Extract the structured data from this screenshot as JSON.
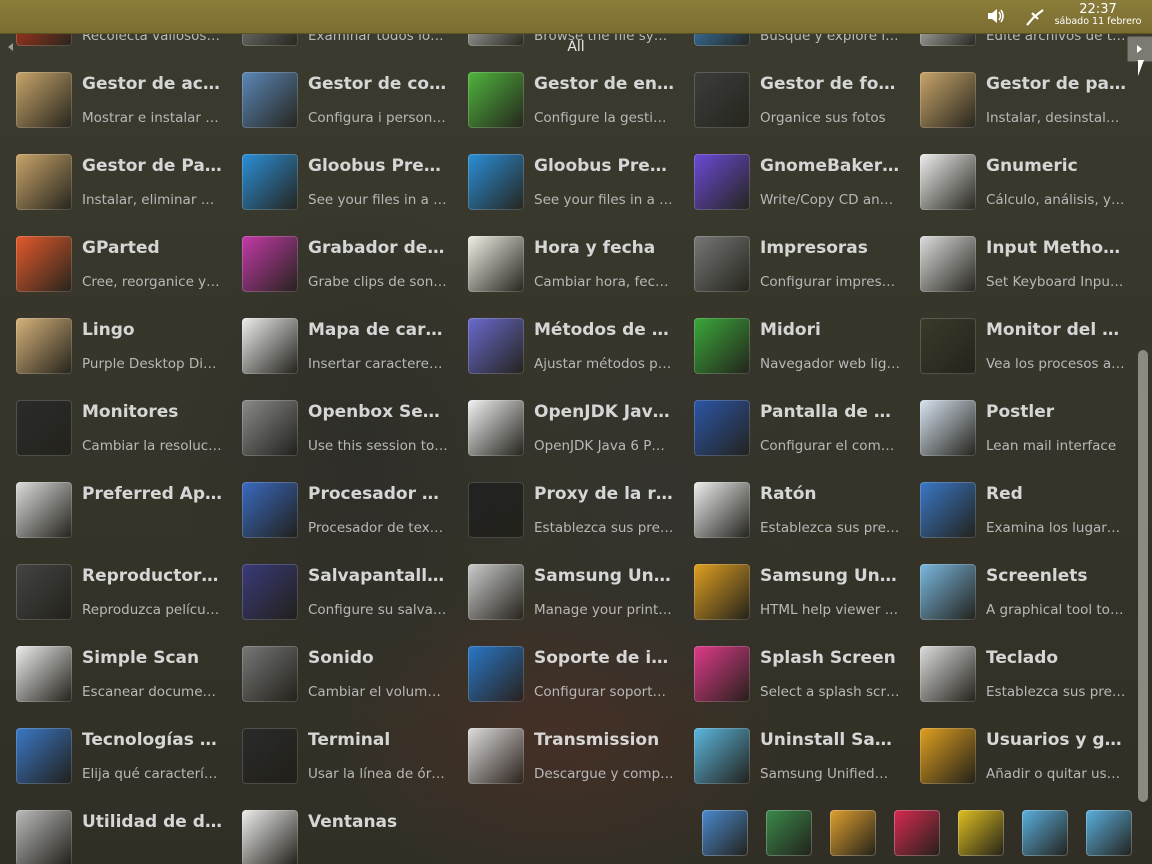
{
  "topbar": {
    "time": "22:37",
    "date": "sábado 11 febrero",
    "icons": [
      "volume-icon",
      "network-icon"
    ]
  },
  "filter": {
    "label": "All"
  },
  "apps": [
    {
      "name": "",
      "desc": "Recolecta valiosos…",
      "icon": "game-icon",
      "color": "#d83a1a"
    },
    {
      "name": "",
      "desc": "Examinar todos los…",
      "icon": "drive-icon",
      "color": "#888"
    },
    {
      "name": "",
      "desc": "Browse the file sys…",
      "icon": "files-icon",
      "color": "#ccc"
    },
    {
      "name": "",
      "desc": "Busque y explore i…",
      "icon": "search-icon",
      "color": "#3b8fd8"
    },
    {
      "name": "",
      "desc": "Edite archivos de t…",
      "icon": "text-editor-icon",
      "color": "#ddd"
    },
    {
      "name": "Gestor de act…",
      "desc": "Mostrar e instalar l…",
      "icon": "package-update-icon",
      "color": "#c9a56a"
    },
    {
      "name": "Gestor de co…",
      "desc": "Configura i person…",
      "icon": "settings-tools-icon",
      "color": "#5b87b8"
    },
    {
      "name": "Gestor de ene…",
      "desc": "Configure la gestió…",
      "icon": "battery-icon",
      "color": "#4fb53c"
    },
    {
      "name": "Gestor de fot…",
      "desc": "Organice sus fotos",
      "icon": "photo-lens-icon",
      "color": "#3c3c3c"
    },
    {
      "name": "Gestor de pa…",
      "desc": "Instalar, desinstala…",
      "icon": "package-install-icon",
      "color": "#c9a56a"
    },
    {
      "name": "Gestor de Pa…",
      "desc": "Instalar, eliminar y …",
      "icon": "package-install-icon",
      "color": "#c9a56a"
    },
    {
      "name": "Gloobus Prev…",
      "desc": "See your files in a …",
      "icon": "gloobus-icon",
      "color": "#2a8fd8"
    },
    {
      "name": "Gloobus Prev…",
      "desc": "See your files in a …",
      "icon": "gloobus-icon",
      "color": "#2a8fd8"
    },
    {
      "name": "GnomeBaker …",
      "desc": "Write/Copy CD an…",
      "icon": "disc-burner-icon",
      "color": "#6b4ad8"
    },
    {
      "name": "Gnumeric",
      "desc": "Cálculo, análisis, y …",
      "icon": "spreadsheet-icon",
      "color": "#eee"
    },
    {
      "name": "GParted",
      "desc": "Cree, reorganice y…",
      "icon": "partition-icon",
      "color": "#e55a2b"
    },
    {
      "name": "Grabador de …",
      "desc": "Grabe clips de sonido",
      "icon": "microphone-icon",
      "color": "#c33aa8"
    },
    {
      "name": "Hora y fecha",
      "desc": "Cambiar hora, fech…",
      "icon": "clock-icon",
      "color": "#f2efe6"
    },
    {
      "name": "Impresoras",
      "desc": "Configurar impreso…",
      "icon": "printer-icon",
      "color": "#777"
    },
    {
      "name": "Input Method …",
      "desc": "Set Keyboard Inpu…",
      "icon": "keyboard-icon",
      "color": "#ddd"
    },
    {
      "name": "Lingo",
      "desc": "Purple Desktop Di…",
      "icon": "dictionary-icon",
      "color": "#d7b27a"
    },
    {
      "name": "Mapa de cara…",
      "desc": "Insertar caracteres…",
      "icon": "character-map-icon",
      "color": "#eee"
    },
    {
      "name": "Métodos de e…",
      "desc": "Ajustar métodos p…",
      "icon": "info-icon",
      "color": "#6a6ad0"
    },
    {
      "name": "Midori",
      "desc": "Navegador web lig…",
      "icon": "compass-icon",
      "color": "#3aa83a"
    },
    {
      "name": "Monitor del si…",
      "desc": "Vea los procesos a…",
      "icon": "system-monitor-icon",
      "color": "#3a3a2a"
    },
    {
      "name": "Monitores",
      "desc": "Cambiar la resoluc…",
      "icon": "display-icon",
      "color": "#2b2b2b"
    },
    {
      "name": "Openbox Ses…",
      "desc": "Use this session to…",
      "icon": "gear-icon",
      "color": "#8a8a8a"
    },
    {
      "name": "OpenJDK Jav…",
      "desc": "OpenJDK Java 6 P…",
      "icon": "java-icon",
      "color": "#f3f3f3"
    },
    {
      "name": "Pantalla de ac…",
      "desc": "Configurar el comp…",
      "icon": "screen-lock-icon",
      "color": "#2c56a8"
    },
    {
      "name": "Postler",
      "desc": "Lean mail interface",
      "icon": "mail-icon",
      "color": "#d8e4f2"
    },
    {
      "name": "Preferred Ap…",
      "desc": "",
      "icon": "sliders-icon",
      "color": "#ddd"
    },
    {
      "name": "Procesador d…",
      "desc": "Procesador de text…",
      "icon": "writer-icon",
      "color": "#3a6ac0"
    },
    {
      "name": "Proxy de la red",
      "desc": "Establezca sus pre…",
      "icon": "network-proxy-icon",
      "color": "#222"
    },
    {
      "name": "Ratón",
      "desc": "Establezca sus pre…",
      "icon": "mouse-icon",
      "color": "#eee"
    },
    {
      "name": "Red",
      "desc": "Examina los lugare…",
      "icon": "network-places-icon",
      "color": "#3a78c8"
    },
    {
      "name": "Reproductor …",
      "desc": "Reproduzca pelícu…",
      "icon": "video-player-icon",
      "color": "#444"
    },
    {
      "name": "Salvapantallas",
      "desc": "Configure su salva…",
      "icon": "screensaver-icon",
      "color": "#3a3a7a"
    },
    {
      "name": "Samsung Uni…",
      "desc": "Manage your print…",
      "icon": "samsung-printer-icon",
      "color": "#ccc"
    },
    {
      "name": "Samsung Uni…",
      "desc": "HTML help viewer …",
      "icon": "help-book-icon",
      "color": "#e0a020"
    },
    {
      "name": "Screenlets",
      "desc": "A graphical tool to …",
      "icon": "screenlets-icon",
      "color": "#7ab8e0"
    },
    {
      "name": "Simple Scan",
      "desc": "Escanear docume…",
      "icon": "scanner-icon",
      "color": "#eee"
    },
    {
      "name": "Sonido",
      "desc": "Cambiar el volume…",
      "icon": "speaker-icon",
      "color": "#777"
    },
    {
      "name": "Soporte de idi…",
      "desc": "Configurar soporte…",
      "icon": "globe-icon",
      "color": "#2a78c8"
    },
    {
      "name": "Splash Screen",
      "desc": "Select a splash scr…",
      "icon": "color-wheel-icon",
      "color": "#e03a8a"
    },
    {
      "name": "Teclado",
      "desc": "Establezca sus pre…",
      "icon": "keyboard-icon",
      "color": "#ddd"
    },
    {
      "name": "Tecnologías …",
      "desc": "Elija qué caracterís…",
      "icon": "accessibility-icon",
      "color": "#3a78c8"
    },
    {
      "name": "Terminal",
      "desc": "Usar la línea de ór…",
      "icon": "terminal-icon",
      "color": "#2a2a2a"
    },
    {
      "name": "Transmission",
      "desc": "Descargue y comp…",
      "icon": "transmission-icon",
      "color": "#ddd"
    },
    {
      "name": "Uninstall Sam…",
      "desc": "Samsung Unified…",
      "icon": "uninstall-icon",
      "color": "#5ab8e0"
    },
    {
      "name": "Usuarios y gr…",
      "desc": "Añadir o quitar usu…",
      "icon": "users-icon",
      "color": "#e0a020"
    },
    {
      "name": "Utilidad de di…",
      "desc": "",
      "icon": "disk-utility-icon",
      "color": "#bbb"
    },
    {
      "name": "Ventanas",
      "desc": "",
      "icon": "windows-icon",
      "color": "#eee"
    }
  ],
  "dock": [
    {
      "icon": "maps-icon",
      "color": "#4a8ad0"
    },
    {
      "icon": "earth-icon",
      "color": "#3a8a4a"
    },
    {
      "icon": "home-folder-icon",
      "color": "#e0a030"
    },
    {
      "icon": "media-player-icon",
      "color": "#d82a50"
    },
    {
      "icon": "launcher-icon",
      "color": "#e0c020"
    },
    {
      "icon": "window-icon",
      "color": "#5ab0e0"
    },
    {
      "icon": "folder-icon",
      "color": "#5ab0e0"
    }
  ]
}
